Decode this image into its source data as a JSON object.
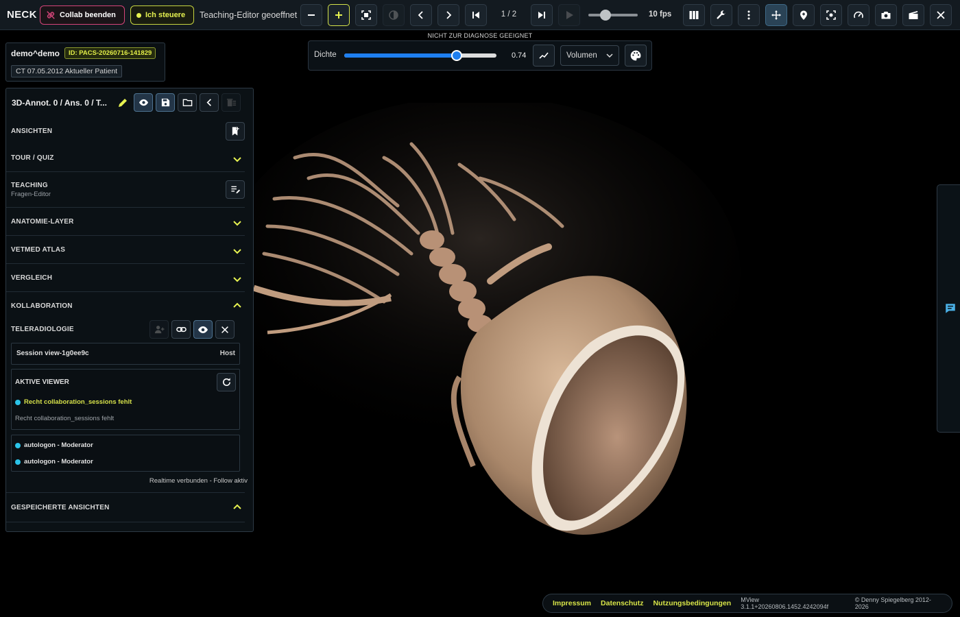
{
  "app": {
    "title": "NECK"
  },
  "toolbar": {
    "collab_label": "Collab beenden",
    "control_label": "Ich steuere",
    "status": "Teaching-Editor geoeffnet",
    "frame_counter": "1 / 2",
    "fps_label": "10 fps",
    "speed_level": 0.35,
    "accent_color": "#d6e44a"
  },
  "density": {
    "warning": "NICHT ZUR DIAGNOSE GEEIGNET",
    "label": "Dichte",
    "value": "0.74",
    "level": 0.74,
    "mode": "Volumen",
    "accent": "#1e7ff0"
  },
  "patient": {
    "name": "demo^demo",
    "id": "ID: PACS-20260716-141829",
    "study": "CT 07.05.2012 Aktueller Patient"
  },
  "panel": {
    "title": "3D-Annot. 0 / Ans. 0 / T...",
    "sections": {
      "ansichten": "ANSICHTEN",
      "tour": "TOUR / QUIZ",
      "teaching": "TEACHING",
      "teaching_sub": "Fragen-Editor",
      "anatomie": "ANATOMIE-LAYER",
      "vetmed": "VETMED ATLAS",
      "vergleich": "VERGLEICH",
      "kollaboration": "KOLLABORATION",
      "gespeichert": "GESPEICHERTE ANSICHTEN"
    },
    "teleradiologie": {
      "title": "TELERADIOLOGIE",
      "session_name": "Session view-1g0ee9c",
      "session_role": "Host",
      "viewer_title": "AKTIVE VIEWER",
      "warning": "Recht collaboration_sessions fehlt",
      "note": "Recht collaboration_sessions fehlt",
      "users": [
        "autologon - Moderator",
        "autologon - Moderator"
      ],
      "realtime": "Realtime verbunden - Follow aktiv"
    }
  },
  "footer": {
    "impressum": "Impressum",
    "datenschutz": "Datenschutz",
    "nutzung": "Nutzungsbedingungen",
    "version": "MView 3.1.1+20260806.1452.4242094f",
    "copyright": "© Denny Spiegelberg 2012-2026"
  }
}
